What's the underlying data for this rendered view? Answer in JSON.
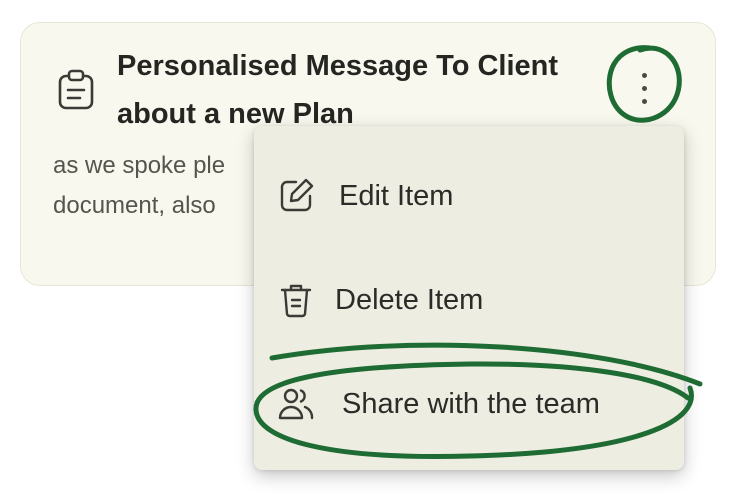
{
  "card": {
    "title": "Personalised Message To Client about a new Plan",
    "body": "as we spoke ple document, also",
    "icon": "clipboard-icon"
  },
  "menu": {
    "items": [
      {
        "label": "Edit Item",
        "icon": "edit-icon"
      },
      {
        "label": "Delete Item",
        "icon": "trash-icon"
      },
      {
        "label": "Share with the team",
        "icon": "users-icon",
        "highlighted": true
      }
    ]
  },
  "colors": {
    "card_bg": "#f8f8ee",
    "menu_bg": "#eeede2",
    "highlight_marker": "#1e6b33",
    "text": "#2b2b28"
  }
}
